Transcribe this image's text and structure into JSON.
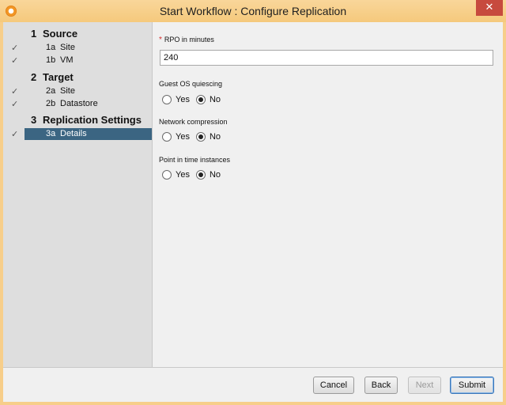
{
  "window": {
    "title": "Start Workflow : Configure Replication",
    "close_glyph": "✕"
  },
  "sidebar": {
    "steps": [
      {
        "number": "1",
        "label": "Source",
        "sub": [
          {
            "number": "1a",
            "label": "Site",
            "done": true
          },
          {
            "number": "1b",
            "label": "VM",
            "done": true
          }
        ]
      },
      {
        "number": "2",
        "label": "Target",
        "sub": [
          {
            "number": "2a",
            "label": "Site",
            "done": true
          },
          {
            "number": "2b",
            "label": "Datastore",
            "done": true
          }
        ]
      },
      {
        "number": "3",
        "label": "Replication Settings",
        "sub": [
          {
            "number": "3a",
            "label": "Details",
            "done": true,
            "selected": true
          }
        ]
      }
    ]
  },
  "form": {
    "rpo": {
      "label": "RPO in minutes",
      "required_mark": "*",
      "value": "240"
    },
    "guest_os_quiescing": {
      "label": "Guest OS quiescing",
      "options": [
        "Yes",
        "No"
      ],
      "selected": "No"
    },
    "network_compression": {
      "label": "Network compression",
      "options": [
        "Yes",
        "No"
      ],
      "selected": "No"
    },
    "point_in_time": {
      "label": "Point in time instances",
      "options": [
        "Yes",
        "No"
      ],
      "selected": "No"
    }
  },
  "footer": {
    "cancel": "Cancel",
    "back": "Back",
    "next": "Next",
    "submit": "Submit"
  },
  "icons": {
    "check": "✓",
    "app": "workflow-app-icon"
  },
  "colors": {
    "titlebar": "#f7ce8a",
    "selection": "#3b6582",
    "close": "#c74a3e",
    "required": "#d62b2b"
  }
}
